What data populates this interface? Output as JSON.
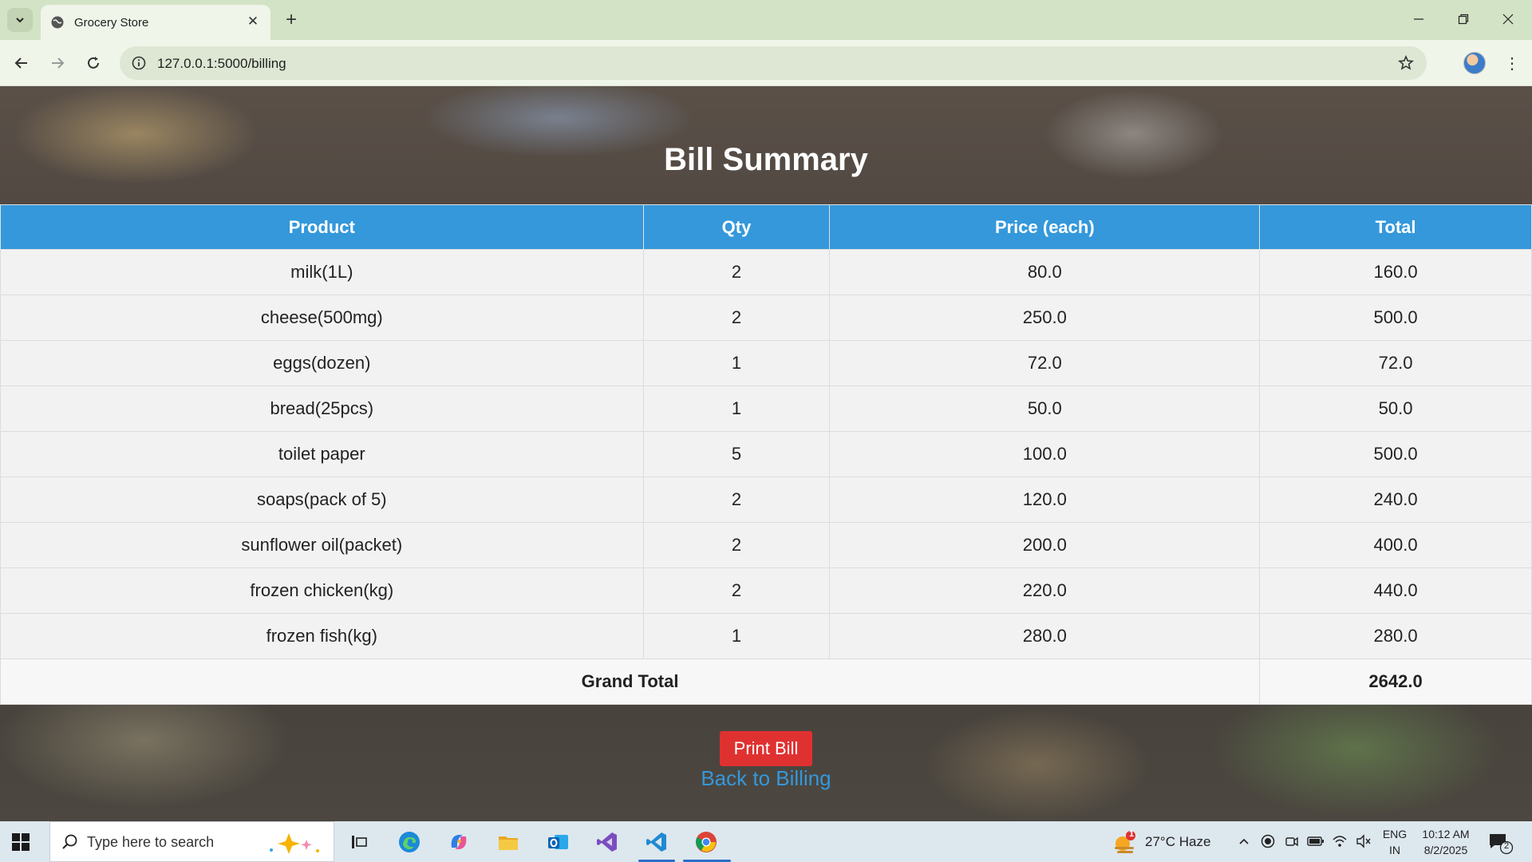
{
  "browser": {
    "tab_title": "Grocery Store",
    "url": "127.0.0.1:5000/billing"
  },
  "page": {
    "title": "Bill Summary",
    "table": {
      "headers": [
        "Product",
        "Qty",
        "Price (each)",
        "Total"
      ],
      "rows": [
        [
          "milk(1L)",
          "2",
          "80.0",
          "160.0"
        ],
        [
          "cheese(500mg)",
          "2",
          "250.0",
          "500.0"
        ],
        [
          "eggs(dozen)",
          "1",
          "72.0",
          "72.0"
        ],
        [
          "bread(25pcs)",
          "1",
          "50.0",
          "50.0"
        ],
        [
          "toilet paper",
          "5",
          "100.0",
          "500.0"
        ],
        [
          "soaps(pack of 5)",
          "2",
          "120.0",
          "240.0"
        ],
        [
          "sunflower oil(packet)",
          "2",
          "200.0",
          "400.0"
        ],
        [
          "frozen chicken(kg)",
          "2",
          "220.0",
          "440.0"
        ],
        [
          "frozen fish(kg)",
          "1",
          "280.0",
          "280.0"
        ]
      ],
      "grand_total_label": "Grand Total",
      "grand_total_value": "2642.0"
    },
    "print_button": "Print Bill",
    "back_link": "Back to Billing"
  },
  "taskbar": {
    "search_placeholder": "Type here to search",
    "weather": "27°C  Haze",
    "weather_badge": "1",
    "lang_line1": "ENG",
    "lang_line2": "IN",
    "time": "10:12 AM",
    "date": "8/2/2025",
    "notification_count": "2"
  },
  "colors": {
    "header_blue": "#3498db",
    "print_red": "#e03131",
    "link_blue": "#3498db"
  }
}
